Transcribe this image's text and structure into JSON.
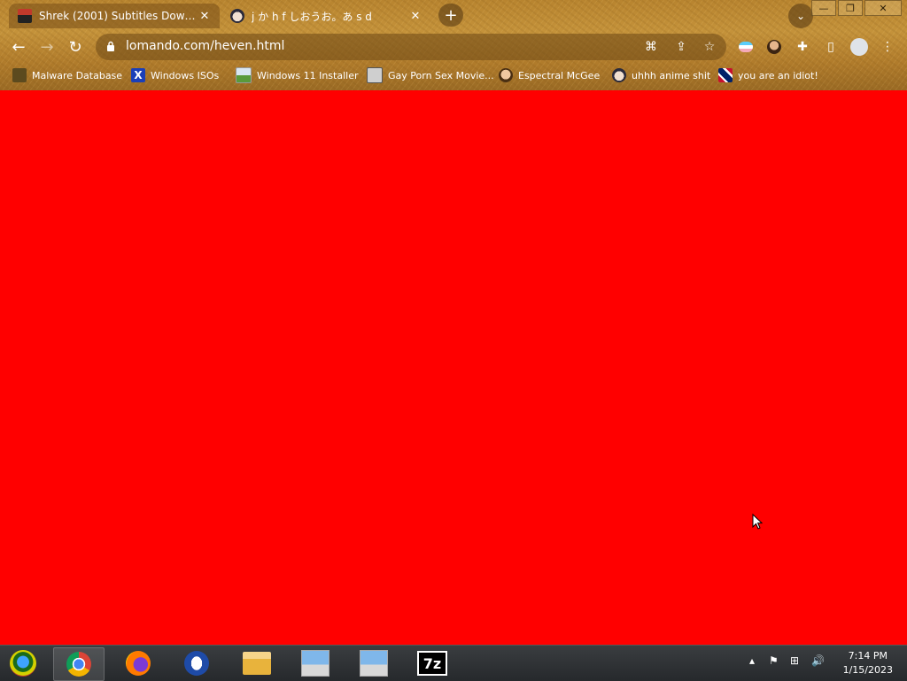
{
  "browser": {
    "tabs": [
      {
        "title": "Shrek (2001) Subtitles Download",
        "active": true
      },
      {
        "title": "j か h f しおうお。あ s d",
        "active": false
      }
    ],
    "address": "lomando.com/heven.html",
    "window_controls": [
      "minimize",
      "restore",
      "close"
    ]
  },
  "bookmarks": [
    {
      "label": "Malware Database",
      "icon": "bug-icon"
    },
    {
      "label": "Windows ISOs",
      "icon": "x-icon"
    },
    {
      "label": "Windows 11 Installer",
      "icon": "image-icon"
    },
    {
      "label": "Gay Porn Sex Movie...",
      "icon": "box-icon"
    },
    {
      "label": "Espectral McGee",
      "icon": "face-icon"
    },
    {
      "label": "uhhh anime shit",
      "icon": "anime-icon"
    },
    {
      "label": "you are an idiot!",
      "icon": "flag-icon"
    }
  ],
  "page": {
    "background": "#ff0000"
  },
  "taskbar": {
    "apps": [
      "start",
      "chrome",
      "firefox",
      "opera",
      "file-explorer",
      "installer",
      "installer",
      "7zip"
    ],
    "sevenzip_label": "7z",
    "time": "7:14 PM",
    "date": "1/15/2023"
  }
}
